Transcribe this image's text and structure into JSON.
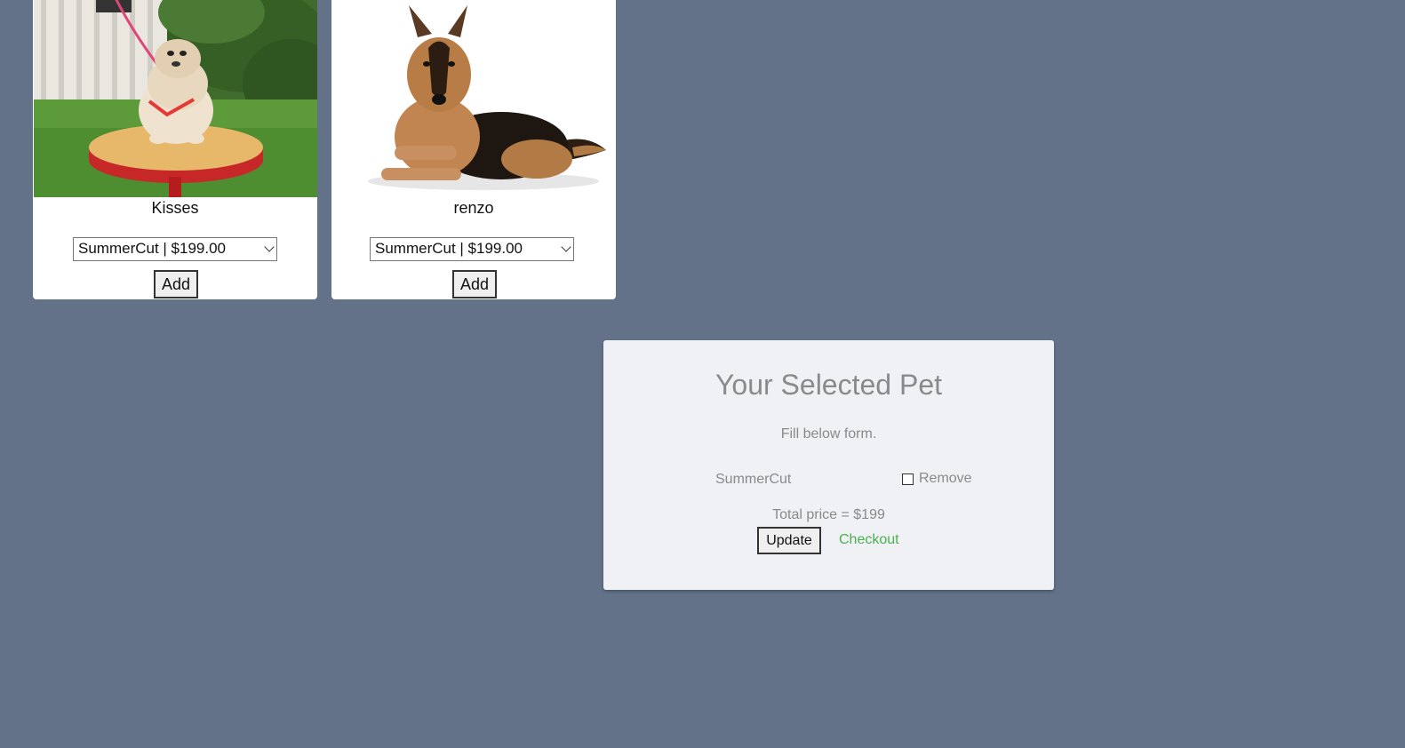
{
  "pets": [
    {
      "name": "Kisses",
      "service_option": "SummerCut | $199.00",
      "add_label": "Add",
      "photo_icon": "dog-photo-icon"
    },
    {
      "name": "renzo",
      "service_option": "SummerCut | $199.00",
      "add_label": "Add",
      "photo_icon": "dog-photo-icon"
    }
  ],
  "selected": {
    "title": "Your Selected Pet",
    "subtitle": "Fill below form.",
    "item_name": "SummerCut",
    "remove_label": "Remove",
    "total_label": "Total price = $199",
    "update_label": "Update",
    "checkout_label": "Checkout"
  },
  "colors": {
    "page_background": "#637289",
    "panel_background": "#f0f1f4",
    "checkout_link": "#4caf50",
    "muted_text": "#8a8a8a"
  }
}
